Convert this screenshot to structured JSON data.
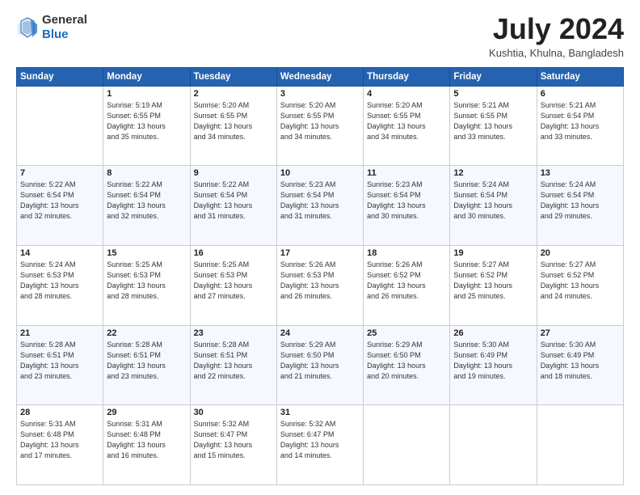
{
  "header": {
    "logo_line1": "General",
    "logo_line2": "Blue",
    "month_year": "July 2024",
    "location": "Kushtia, Khulna, Bangladesh"
  },
  "days_of_week": [
    "Sunday",
    "Monday",
    "Tuesday",
    "Wednesday",
    "Thursday",
    "Friday",
    "Saturday"
  ],
  "weeks": [
    [
      {
        "day": "",
        "info": ""
      },
      {
        "day": "1",
        "info": "Sunrise: 5:19 AM\nSunset: 6:55 PM\nDaylight: 13 hours\nand 35 minutes."
      },
      {
        "day": "2",
        "info": "Sunrise: 5:20 AM\nSunset: 6:55 PM\nDaylight: 13 hours\nand 34 minutes."
      },
      {
        "day": "3",
        "info": "Sunrise: 5:20 AM\nSunset: 6:55 PM\nDaylight: 13 hours\nand 34 minutes."
      },
      {
        "day": "4",
        "info": "Sunrise: 5:20 AM\nSunset: 6:55 PM\nDaylight: 13 hours\nand 34 minutes."
      },
      {
        "day": "5",
        "info": "Sunrise: 5:21 AM\nSunset: 6:55 PM\nDaylight: 13 hours\nand 33 minutes."
      },
      {
        "day": "6",
        "info": "Sunrise: 5:21 AM\nSunset: 6:54 PM\nDaylight: 13 hours\nand 33 minutes."
      }
    ],
    [
      {
        "day": "7",
        "info": "Sunrise: 5:22 AM\nSunset: 6:54 PM\nDaylight: 13 hours\nand 32 minutes."
      },
      {
        "day": "8",
        "info": "Sunrise: 5:22 AM\nSunset: 6:54 PM\nDaylight: 13 hours\nand 32 minutes."
      },
      {
        "day": "9",
        "info": "Sunrise: 5:22 AM\nSunset: 6:54 PM\nDaylight: 13 hours\nand 31 minutes."
      },
      {
        "day": "10",
        "info": "Sunrise: 5:23 AM\nSunset: 6:54 PM\nDaylight: 13 hours\nand 31 minutes."
      },
      {
        "day": "11",
        "info": "Sunrise: 5:23 AM\nSunset: 6:54 PM\nDaylight: 13 hours\nand 30 minutes."
      },
      {
        "day": "12",
        "info": "Sunrise: 5:24 AM\nSunset: 6:54 PM\nDaylight: 13 hours\nand 30 minutes."
      },
      {
        "day": "13",
        "info": "Sunrise: 5:24 AM\nSunset: 6:54 PM\nDaylight: 13 hours\nand 29 minutes."
      }
    ],
    [
      {
        "day": "14",
        "info": "Sunrise: 5:24 AM\nSunset: 6:53 PM\nDaylight: 13 hours\nand 28 minutes."
      },
      {
        "day": "15",
        "info": "Sunrise: 5:25 AM\nSunset: 6:53 PM\nDaylight: 13 hours\nand 28 minutes."
      },
      {
        "day": "16",
        "info": "Sunrise: 5:25 AM\nSunset: 6:53 PM\nDaylight: 13 hours\nand 27 minutes."
      },
      {
        "day": "17",
        "info": "Sunrise: 5:26 AM\nSunset: 6:53 PM\nDaylight: 13 hours\nand 26 minutes."
      },
      {
        "day": "18",
        "info": "Sunrise: 5:26 AM\nSunset: 6:52 PM\nDaylight: 13 hours\nand 26 minutes."
      },
      {
        "day": "19",
        "info": "Sunrise: 5:27 AM\nSunset: 6:52 PM\nDaylight: 13 hours\nand 25 minutes."
      },
      {
        "day": "20",
        "info": "Sunrise: 5:27 AM\nSunset: 6:52 PM\nDaylight: 13 hours\nand 24 minutes."
      }
    ],
    [
      {
        "day": "21",
        "info": "Sunrise: 5:28 AM\nSunset: 6:51 PM\nDaylight: 13 hours\nand 23 minutes."
      },
      {
        "day": "22",
        "info": "Sunrise: 5:28 AM\nSunset: 6:51 PM\nDaylight: 13 hours\nand 23 minutes."
      },
      {
        "day": "23",
        "info": "Sunrise: 5:28 AM\nSunset: 6:51 PM\nDaylight: 13 hours\nand 22 minutes."
      },
      {
        "day": "24",
        "info": "Sunrise: 5:29 AM\nSunset: 6:50 PM\nDaylight: 13 hours\nand 21 minutes."
      },
      {
        "day": "25",
        "info": "Sunrise: 5:29 AM\nSunset: 6:50 PM\nDaylight: 13 hours\nand 20 minutes."
      },
      {
        "day": "26",
        "info": "Sunrise: 5:30 AM\nSunset: 6:49 PM\nDaylight: 13 hours\nand 19 minutes."
      },
      {
        "day": "27",
        "info": "Sunrise: 5:30 AM\nSunset: 6:49 PM\nDaylight: 13 hours\nand 18 minutes."
      }
    ],
    [
      {
        "day": "28",
        "info": "Sunrise: 5:31 AM\nSunset: 6:48 PM\nDaylight: 13 hours\nand 17 minutes."
      },
      {
        "day": "29",
        "info": "Sunrise: 5:31 AM\nSunset: 6:48 PM\nDaylight: 13 hours\nand 16 minutes."
      },
      {
        "day": "30",
        "info": "Sunrise: 5:32 AM\nSunset: 6:47 PM\nDaylight: 13 hours\nand 15 minutes."
      },
      {
        "day": "31",
        "info": "Sunrise: 5:32 AM\nSunset: 6:47 PM\nDaylight: 13 hours\nand 14 minutes."
      },
      {
        "day": "",
        "info": ""
      },
      {
        "day": "",
        "info": ""
      },
      {
        "day": "",
        "info": ""
      }
    ]
  ]
}
